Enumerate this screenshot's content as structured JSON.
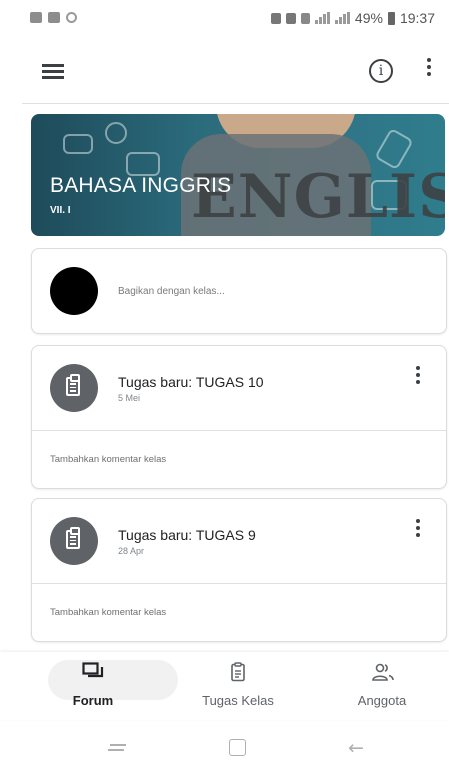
{
  "status_bar": {
    "battery": "49%",
    "time": "19:37"
  },
  "app_bar": {
    "menu_icon": "hamburger-menu-icon",
    "info_icon": "info-icon",
    "more_icon": "more-vert-icon"
  },
  "class_banner": {
    "title": "BAHASA INGGRIS",
    "section": "VII. I",
    "background_word": "ENGLISH",
    "theme_color": "#2b6b7c"
  },
  "share_box": {
    "placeholder": "Bagikan dengan kelas..."
  },
  "stream": [
    {
      "title": "Tugas baru: TUGAS 10",
      "date": "5 Mei",
      "comment_prompt": "Tambahkan komentar kelas"
    },
    {
      "title": "Tugas baru: TUGAS 9",
      "date": "28 Apr",
      "comment_prompt": "Tambahkan komentar kelas"
    }
  ],
  "bottom_nav": {
    "items": [
      {
        "label": "Forum",
        "icon": "forum-icon",
        "active": true
      },
      {
        "label": "Tugas Kelas",
        "icon": "classwork-icon",
        "active": false
      },
      {
        "label": "Anggota",
        "icon": "people-icon",
        "active": false
      }
    ]
  },
  "colors": {
    "icon_grey": "#5f6368",
    "divider": "#e0e0e0"
  }
}
